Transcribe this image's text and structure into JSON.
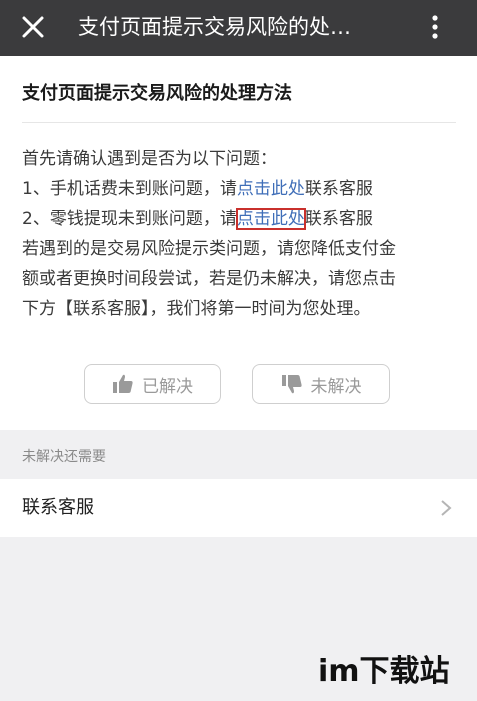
{
  "header": {
    "title": "支付页面提示交易风险的处…",
    "close_icon": "close-icon",
    "more_icon": "more-vertical-icon"
  },
  "article": {
    "title": "支付页面提示交易风险的处理方法",
    "intro": "首先请确认遇到是否为以下问题：",
    "item1_prefix": "1、手机话费未到账问题，请",
    "item1_link": "点击此处",
    "item1_suffix": "联系客服",
    "item2_prefix": "2、零钱提现未到账问题，请",
    "item2_link": "点击此处",
    "item2_suffix": "联系客服",
    "para_line1": "若遇到的是交易风险提示类问题，请您降低支付金",
    "para_line2": "额或者更换时间段尝试，若是仍未解决，请您点击",
    "para_line3": "下方【联系客服】，我们将第一时间为您处理。"
  },
  "feedback": {
    "solved_label": "已解决",
    "unsolved_label": "未解决",
    "solved_icon": "thumbs-up-icon",
    "unsolved_icon": "thumbs-down-icon"
  },
  "section": {
    "label": "未解决还需要"
  },
  "menu": {
    "contact_label": "联系客服",
    "chevron_icon": "chevron-right-icon"
  },
  "watermark": {
    "text": "im下载站"
  },
  "colors": {
    "topbar": "#3b3b3d",
    "link": "#3f6eb8",
    "highlight_box": "#c9302c",
    "background": "#f0f0f2"
  }
}
